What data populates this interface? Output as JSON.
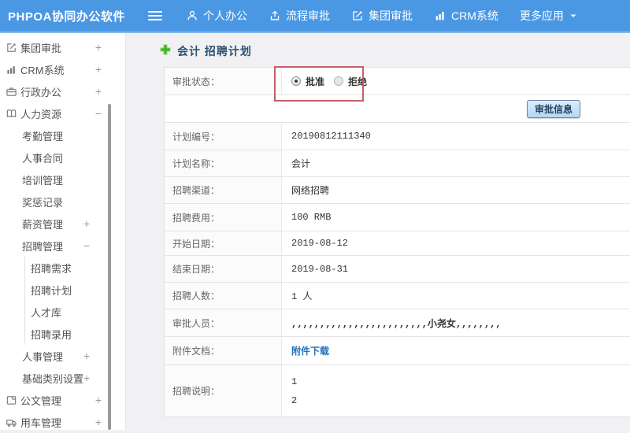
{
  "navbar": {
    "brand": "PHPOA协同办公软件",
    "items": [
      {
        "label": "个人办公",
        "icon": "person-icon"
      },
      {
        "label": "流程审批",
        "icon": "upload-arrow-icon"
      },
      {
        "label": "集团审批",
        "icon": "edit-square-icon"
      },
      {
        "label": "CRM系统",
        "icon": "bar-chart-icon"
      },
      {
        "label": "更多应用",
        "icon": "caret-down-icon"
      }
    ]
  },
  "sidebar": {
    "items": [
      {
        "label": "集团审批",
        "level": 1,
        "icon": "edit-square-icon",
        "toggle": "+"
      },
      {
        "label": "CRM系统",
        "level": 1,
        "icon": "bar-chart-icon",
        "toggle": "+"
      },
      {
        "label": "行政办公",
        "level": 1,
        "icon": "briefcase-icon",
        "toggle": "+"
      },
      {
        "label": "人力资源",
        "level": 1,
        "icon": "book-icon",
        "toggle": "−"
      },
      {
        "label": "考勤管理",
        "level": 2
      },
      {
        "label": "人事合同",
        "level": 2
      },
      {
        "label": "培训管理",
        "level": 2
      },
      {
        "label": "奖惩记录",
        "level": 2
      },
      {
        "label": "薪资管理",
        "level": 2,
        "toggle": "+"
      },
      {
        "label": "招聘管理",
        "level": 2,
        "toggle": "−"
      },
      {
        "label": "招聘需求",
        "level": 3
      },
      {
        "label": "招聘计划",
        "level": 3
      },
      {
        "label": "人才库",
        "level": 3
      },
      {
        "label": "招聘录用",
        "level": 3
      },
      {
        "label": "人事管理",
        "level": 2,
        "toggle": "+"
      },
      {
        "label": "基础类别设置",
        "level": 2,
        "toggle": "+"
      },
      {
        "label": "公文管理",
        "level": 1,
        "icon": "document-icon",
        "toggle": "+"
      },
      {
        "label": "用车管理",
        "level": 1,
        "icon": "truck-icon",
        "toggle": "+"
      }
    ]
  },
  "main": {
    "title": "会计 招聘计划",
    "status": {
      "label": "审批状态：",
      "options": [
        {
          "label": "批准",
          "checked": true
        },
        {
          "label": "拒绝",
          "checked": false
        }
      ]
    },
    "approve_button": "审批信息",
    "rows": [
      {
        "label": "计划编号：",
        "value": "20190812111340"
      },
      {
        "label": "计划名称：",
        "value": "会计"
      },
      {
        "label": "招聘渠道：",
        "value": "网络招聘"
      },
      {
        "label": "招聘费用：",
        "value": "100 RMB"
      },
      {
        "label": "开始日期：",
        "value": "2019-08-12"
      },
      {
        "label": "结束日期：",
        "value": "2019-08-31"
      },
      {
        "label": "招聘人数：",
        "value": "1 人"
      },
      {
        "label": "审批人员：",
        "value": ",,,,,,,,,,,,,,,,,,,,,,,,小尧女,,,,,,,,"
      },
      {
        "label": "附件文档：",
        "value": "附件下载",
        "is_link": true
      },
      {
        "label": "招聘说明：",
        "lines": [
          "1",
          "2"
        ]
      }
    ]
  },
  "colors": {
    "navbar_blue": "#4a97e4",
    "annotation_red": "#c2606b",
    "link_blue": "#2173bd",
    "plus_green": "#3cb52e",
    "button_face": "#b1d6f3"
  }
}
